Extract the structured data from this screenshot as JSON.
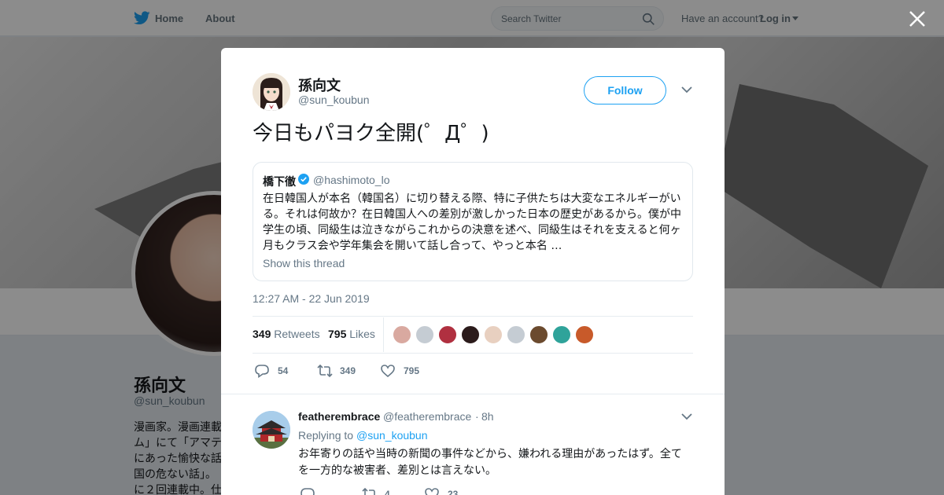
{
  "nav": {
    "home_label": "Home",
    "about_label": "About",
    "search_placeholder": "Search Twitter",
    "have_account": "Have an account?",
    "login_label": "Log in"
  },
  "profile": {
    "name": "孫向文",
    "handle": "@sun_koubun",
    "bio_visible": "漫画家。漫画連載\nム」にて「アマテ\nにあった愉快な話\n国の危ない話」。\nに２回連載中。仕"
  },
  "tweet": {
    "author_name": "孫向文",
    "author_handle": "@sun_koubun",
    "follow_label": "Follow",
    "text": "今日もパヨク全開(゜Д゜)",
    "quote": {
      "name": "橋下徹",
      "handle": "@hashimoto_lo",
      "body": "在日韓国人が本名（韓国名）に切り替える際、特に子供たちは大変なエネルギーがいる。それは何故か？在日韓国人への差別が激しかった日本の歴史があるから。僕が中学生の頃、同級生は泣きながらこれからの決意を述べ、同級生はそれを支えると何ヶ月もクラス会や学年集会を開いて話し合って、やっと本名 …",
      "thread_label": "Show this thread"
    },
    "timestamp": "12:27 AM - 22 Jun 2019",
    "retweets_count": "349",
    "retweets_label": "Retweets",
    "likes_count": "795",
    "likes_label": "Likes",
    "actions": {
      "reply_count": "54",
      "retweet_count": "349",
      "like_count": "795"
    },
    "liker_colors": [
      "#d9a9a0",
      "#c5ccd3",
      "#b03040",
      "#2b1b1b",
      "#e8d0c0",
      "#c5ccd3",
      "#6b4a2e",
      "#2fa39a",
      "#c85a2a"
    ]
  },
  "reply": {
    "name": "featherembrace",
    "handle": "@featherembrace",
    "separator": "·",
    "time": "8h",
    "replying_to_label": "Replying to",
    "replying_to_handle": "@sun_koubun",
    "text": "お年寄りの話や当時の新聞の事件などから、嫌われる理由があったはず。全てを一方的な被害者、差別とは言えない。",
    "reply_count": "",
    "retweet_count": "4",
    "like_count": "23"
  },
  "colors": {
    "accent": "#1da1f2",
    "text_secondary": "#657786",
    "like_red": "#e0245e"
  }
}
